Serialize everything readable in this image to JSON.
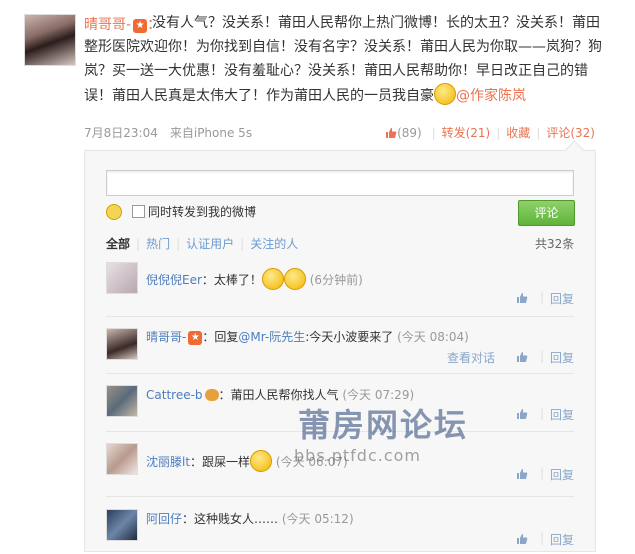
{
  "post": {
    "author": "晴哥哥-",
    "author_suffix": "：",
    "text": "没有人气？没关系！莆田人民帮你上热门微博！长的太丑？没关系！莆田整形医院欢迎你！为你找到自信！没有名字？没关系！莆田人民为你取——岚狗？狗岚？买一送一大优惠！没有羞耻心？没关系！莆田人民帮助你！早日改正自己的错误！莆田人民真是太伟大了！作为莆田人民的一员我自豪",
    "mention": "@作家陈岚",
    "time": "7月8日23:04",
    "source": "来自iPhone 5s",
    "like_count": "(89)",
    "repost_label": "转发(21)",
    "collect_label": "收藏",
    "comment_label": "评论(32)"
  },
  "composer": {
    "repost_also_label": "同时转发到我的微博",
    "submit_label": "评论"
  },
  "filters": {
    "tabs": [
      "全部",
      "热门",
      "认证用户",
      "关注的人"
    ],
    "total": "共32条"
  },
  "comments": [
    {
      "name": "倪倪倪Eer",
      "text": "：太棒了！",
      "time": "(6分钟前)",
      "reply": "回复"
    },
    {
      "name": "晴哥哥-",
      "text": "：回复",
      "mention": "@Mr-阮先生",
      "text2": ":今天小波要来了",
      "time": "(今天 08:04)",
      "view": "查看对话",
      "reply": "回复"
    },
    {
      "name": "Cattree-b",
      "text": "：莆田人民帮你找人气",
      "time": "(今天 07:29)",
      "reply": "回复"
    },
    {
      "name": "沈丽滕lt",
      "text": "：跟屎一样",
      "time": "(今天 06:07)",
      "reply": "回复"
    },
    {
      "name": "阿回仔",
      "text": "：这种贱女人……",
      "time": "(今天 05:12)",
      "reply": "回复"
    }
  ],
  "watermark": {
    "title": "莆房网论坛",
    "url": "bbs.ptfdc.com"
  }
}
